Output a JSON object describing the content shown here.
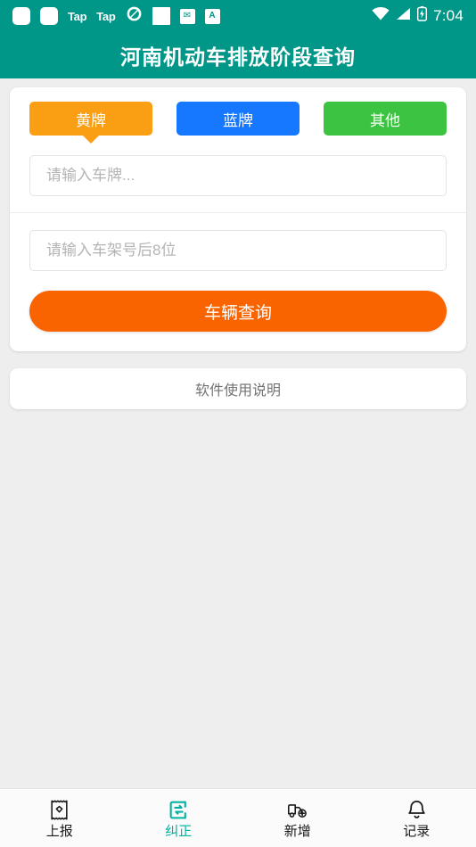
{
  "status_bar": {
    "icons": [
      "rounded-square-icon",
      "rounded-square-icon",
      "tap-icon",
      "tap-icon",
      "sync-icon",
      "square-icon",
      "mail-icon",
      "letter-a-icon"
    ],
    "tap_label": "Tap",
    "mail_glyph": "✉",
    "letter_glyph": "A",
    "wifi_icon": "wifi-icon",
    "signal_icon": "signal-icon",
    "battery_icon": "battery-icon",
    "time": "7:04"
  },
  "app_bar": {
    "title": "河南机动车排放阶段查询"
  },
  "theme": {
    "primary": "#009688",
    "orange_tab": "#fa9e14",
    "blue_tab": "#1677ff",
    "green_tab": "#3dc342",
    "submit_orange": "#fa6400",
    "active_nav": "#00b3a0",
    "page_background": "#efeeee"
  },
  "main_card": {
    "tabs": [
      {
        "label": "黄牌",
        "color": "#fa9e14",
        "active": true
      },
      {
        "label": "蓝牌",
        "color": "#1677ff",
        "active": false
      },
      {
        "label": "其他",
        "color": "#3dc342",
        "active": false
      }
    ],
    "plate_input": {
      "value": "",
      "placeholder": "请输入车牌..."
    },
    "vin_input": {
      "value": "",
      "placeholder": "请输入车架号后8位"
    },
    "submit_label": "车辆查询"
  },
  "help_card": {
    "label": "软件使用说明"
  },
  "bottom_nav": {
    "items": [
      {
        "label": "上报",
        "icon": "receipt-icon",
        "active": false
      },
      {
        "label": "纠正",
        "icon": "document-exchange-icon",
        "active": true
      },
      {
        "label": "新增",
        "icon": "truck-plus-icon",
        "active": false
      },
      {
        "label": "记录",
        "icon": "bell-icon",
        "active": false
      }
    ]
  }
}
